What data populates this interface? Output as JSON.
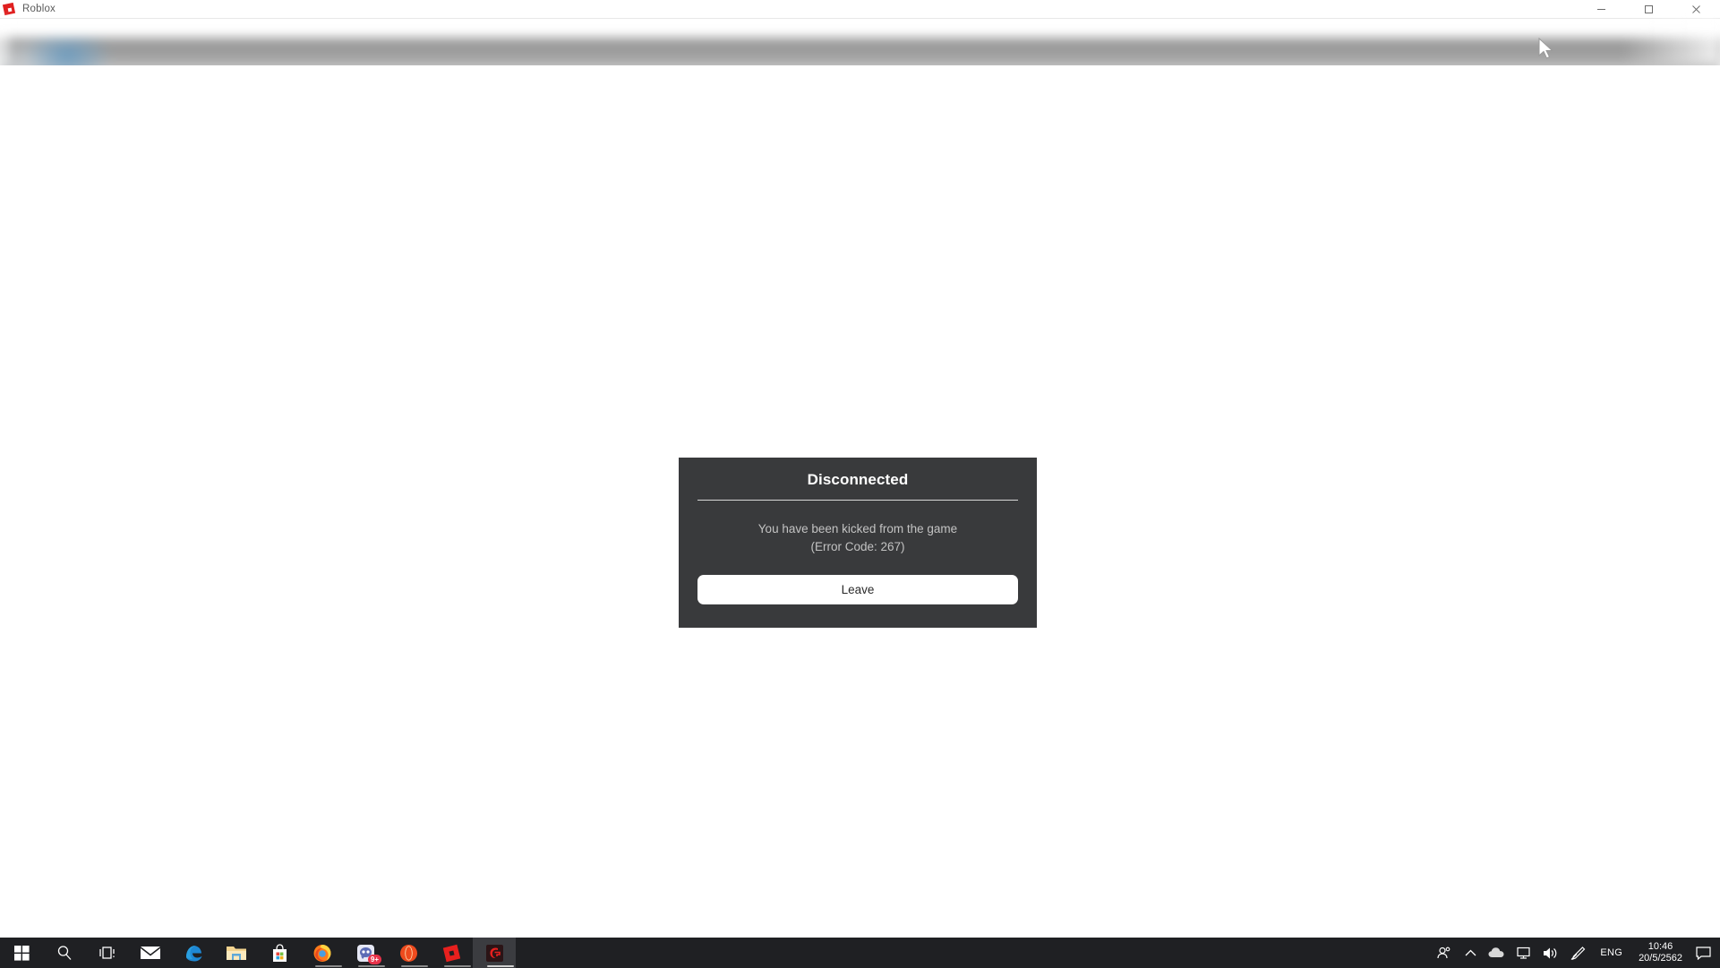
{
  "window": {
    "title": "Roblox",
    "logo_icon": "roblox-logo-icon",
    "controls": {
      "minimize": "minimize-icon",
      "maximize": "maximize-icon",
      "close": "close-icon"
    }
  },
  "cursor": {
    "icon": "mouse-pointer-icon"
  },
  "dialog": {
    "title": "Disconnected",
    "message_line1": "You have been kicked from the game",
    "message_line2": "(Error Code: 267)",
    "button_label": "Leave",
    "background_color": "#393a3c",
    "button_color": "#ffffff",
    "title_color": "#ffffff",
    "message_color": "#c3c3c3"
  },
  "taskbar": {
    "items": [
      {
        "name": "start-button",
        "icon": "windows-logo-icon",
        "running": false
      },
      {
        "name": "search-button",
        "icon": "search-icon",
        "running": false
      },
      {
        "name": "task-view-button",
        "icon": "task-view-icon",
        "running": false
      },
      {
        "name": "mail-app",
        "icon": "mail-icon",
        "running": false
      },
      {
        "name": "edge-browser",
        "icon": "edge-icon",
        "running": false
      },
      {
        "name": "file-explorer",
        "icon": "folder-icon",
        "running": false
      },
      {
        "name": "microsoft-store",
        "icon": "store-icon",
        "running": false
      },
      {
        "name": "firefox-browser",
        "icon": "firefox-icon",
        "running": true
      },
      {
        "name": "messenger-app",
        "icon": "messenger-icon",
        "running": true,
        "badge": "9+"
      },
      {
        "name": "opera-browser",
        "icon": "opera-icon",
        "running": true
      },
      {
        "name": "roblox-app",
        "icon": "roblox-icon",
        "running": true
      },
      {
        "name": "garena-app",
        "icon": "garena-icon",
        "running": true,
        "active": true
      }
    ]
  },
  "tray": {
    "icons": [
      {
        "name": "people-icon",
        "glyph": "people"
      },
      {
        "name": "show-hidden-icons-chevron",
        "glyph": "chevron-up"
      },
      {
        "name": "onedrive-icon",
        "glyph": "cloud"
      },
      {
        "name": "network-icon",
        "glyph": "monitor"
      },
      {
        "name": "volume-icon",
        "glyph": "speaker"
      },
      {
        "name": "pen-icon",
        "glyph": "pen"
      }
    ],
    "language": "ENG",
    "time": "10:46",
    "date": "20/5/2562",
    "notification_icon": "action-center-icon"
  }
}
